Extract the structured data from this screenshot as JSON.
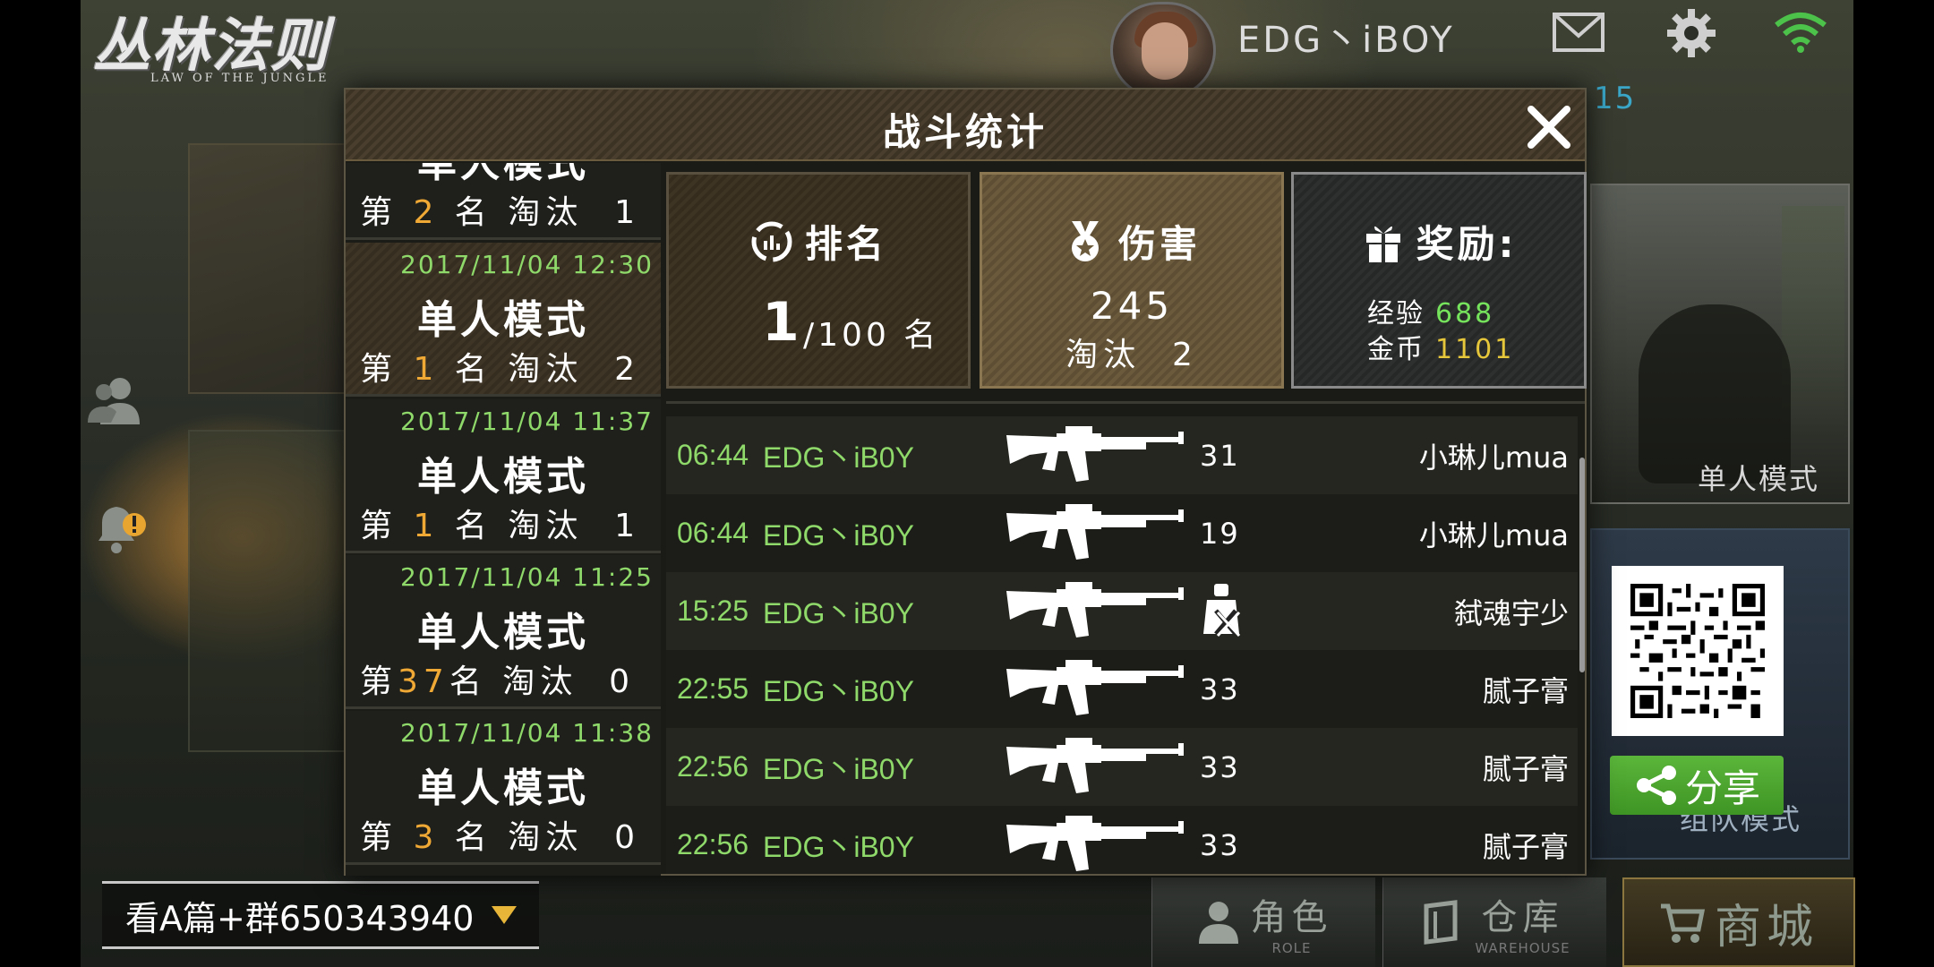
{
  "logo": {
    "main": "丛林法则",
    "sub": "LAW OF THE JUNGLE"
  },
  "header": {
    "player_name": "EDG丶iBOY",
    "level_fragment": "15"
  },
  "icons": {
    "mail": "mail-icon",
    "settings": "gear-icon",
    "wifi": "wifi-icon",
    "friends": "friends-icon",
    "alerts": "alert-icon",
    "close": "close-icon",
    "share": "share-icon",
    "ranking": "ranking-icon",
    "damage": "medal-icon",
    "reward": "gift-icon",
    "weapon": "rifle-icon",
    "fall": "fall-damage-icon"
  },
  "modal": {
    "title": "战斗统计",
    "history": [
      {
        "date": "",
        "mode": "单人模式",
        "rank_prefix": "第 ",
        "rank": "2",
        "rank_suffix": " 名 淘汰  1"
      },
      {
        "date": "2017/11/04 12:30",
        "mode": "单人模式",
        "rank_prefix": "第 ",
        "rank": "1",
        "rank_suffix": " 名 淘汰  2"
      },
      {
        "date": "2017/11/04 11:37",
        "mode": "单人模式",
        "rank_prefix": "第 ",
        "rank": "1",
        "rank_suffix": " 名 淘汰  1"
      },
      {
        "date": "2017/11/04 11:25",
        "mode": "单人模式",
        "rank_prefix": "第",
        "rank": "37",
        "rank_suffix": "名 淘汰  0"
      },
      {
        "date": "2017/11/04 11:38",
        "mode": "单人模式",
        "rank_prefix": "第 ",
        "rank": "3",
        "rank_suffix": " 名 淘汰  0"
      }
    ],
    "rank_card": {
      "title": "排名",
      "value": "1",
      "total": "/100 名"
    },
    "damage_card": {
      "title": "伤害",
      "value": "245",
      "kills": "淘汰  2"
    },
    "reward_card": {
      "title": "奖励:",
      "exp_label": "经验",
      "exp_value": "688",
      "coin_label": "金币",
      "coin_value": "1101"
    },
    "kill_log": [
      {
        "time": "06:44",
        "killer": "EDG丶iB0Y",
        "distance": "31",
        "victim": "小琳儿mua"
      },
      {
        "time": "06:44",
        "killer": "EDG丶iB0Y",
        "distance": "19",
        "victim": "小琳儿mua"
      },
      {
        "time": "15:25",
        "killer": "EDG丶iB0Y",
        "distance": "",
        "victim": "弑魂宇少"
      },
      {
        "time": "22:55",
        "killer": "EDG丶iB0Y",
        "distance": "33",
        "victim": "腻子膏"
      },
      {
        "time": "22:56",
        "killer": "EDG丶iB0Y",
        "distance": "33",
        "victim": "腻子膏"
      },
      {
        "time": "22:56",
        "killer": "EDG丶iB0Y",
        "distance": "33",
        "victim": "腻子膏"
      }
    ]
  },
  "right_panel": {
    "solo_mode": "单人模式",
    "team_mode": "组队模式",
    "share_label": "分享"
  },
  "bottom": {
    "group_text": "看A篇+群650343940",
    "tabs": [
      {
        "label": "角色",
        "sub": "ROLE"
      },
      {
        "label": "仓库",
        "sub": "WAREHOUSE"
      },
      {
        "label": "商城",
        "sub": ""
      }
    ]
  },
  "colors": {
    "accent_green": "#8ed96a",
    "rank_orange": "#f0a935",
    "exp_green": "#76e35c",
    "coin_yellow": "#e6c63a",
    "share_green": "#4ea82f"
  }
}
